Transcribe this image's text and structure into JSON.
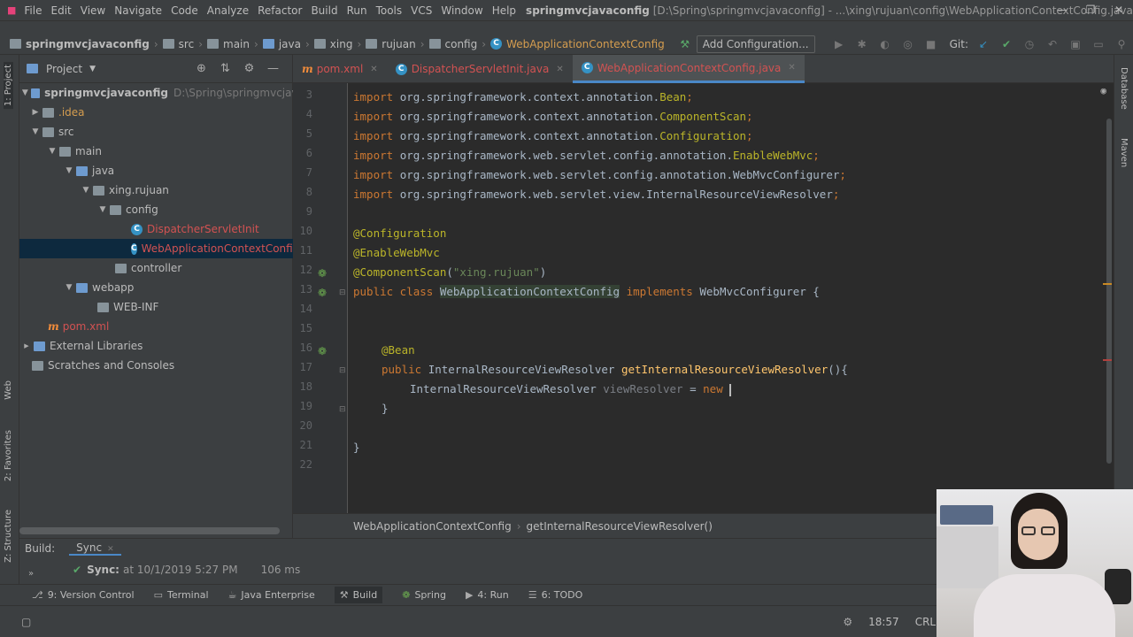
{
  "menubar": {
    "items": [
      "File",
      "Edit",
      "View",
      "Navigate",
      "Code",
      "Analyze",
      "Refactor",
      "Build",
      "Run",
      "Tools",
      "VCS",
      "Window",
      "Help"
    ],
    "title_bold": "springmvcjavaconfig",
    "title_rest": " [D:\\Spring\\springmvcjavaconfig] - ...\\xing\\rujuan\\config\\WebApplicationContextConfig.java"
  },
  "breadcrumb": {
    "items": [
      "springmvcjavaconfig",
      "src",
      "main",
      "java",
      "xing",
      "rujuan",
      "config",
      "WebApplicationContextConfig"
    ]
  },
  "toolbar": {
    "add_configuration": "Add Configuration...",
    "git_label": "Git:"
  },
  "left_stripe": {
    "project": "1: Project",
    "web": "Web",
    "favorites": "2: Favorites",
    "structure": "Z: Structure"
  },
  "right_stripe": {
    "database": "Database",
    "maven": "Maven"
  },
  "project_panel": {
    "title": "Project",
    "tree": [
      {
        "label": "springmvcjavaconfig",
        "path": "D:\\Spring\\springmvcjavacon"
      },
      {
        "label": ".idea"
      },
      {
        "label": "src"
      },
      {
        "label": "main"
      },
      {
        "label": "java"
      },
      {
        "label": "xing.rujuan"
      },
      {
        "label": "config"
      },
      {
        "label": "DispatcherServletInit"
      },
      {
        "label": "WebApplicationContextConfig"
      },
      {
        "label": "controller"
      },
      {
        "label": "webapp"
      },
      {
        "label": "WEB-INF"
      },
      {
        "label": "pom.xml"
      },
      {
        "label": "External Libraries"
      },
      {
        "label": "Scratches and Consoles"
      }
    ]
  },
  "tabs": [
    {
      "label": "pom.xml"
    },
    {
      "label": "DispatcherServletInit.java"
    },
    {
      "label": "WebApplicationContextConfig.java"
    }
  ],
  "editor": {
    "line_numbers": [
      "3",
      "4",
      "5",
      "6",
      "7",
      "8",
      "9",
      "10",
      "11",
      "12",
      "13",
      "14",
      "15",
      "16",
      "17",
      "18",
      "19",
      "20",
      "21",
      "22"
    ],
    "lines": {
      "l3_pkg": "org.springframework.context.annotation.",
      "l3_cls": "Bean",
      "l4_pkg": "org.springframework.context.annotation.",
      "l4_cls": "ComponentScan",
      "l5_pkg": "org.springframework.context.annotation.",
      "l5_cls": "Configuration",
      "l6_pkg": "org.springframework.web.servlet.config.annotation.",
      "l6_cls": "EnableWebMvc",
      "l7_pkg": "org.springframework.web.servlet.config.annotation.",
      "l7_cls": "WebMvcConfigurer",
      "l8_pkg": "org.springframework.web.servlet.view.",
      "l8_cls": "InternalResourceViewResolver",
      "import_kw": "import",
      "ann_configuration": "@Configuration",
      "ann_enablewebmvc": "@EnableWebMvc",
      "ann_componentscan": "@ComponentScan",
      "scan_arg": "\"xing.rujuan\"",
      "public_class": "public class",
      "class_name": "WebApplicationContextConfig",
      "implements": "implements",
      "interface": "WebMvcConfigurer {",
      "ann_bean": "@Bean",
      "public_kw": "public",
      "return_type": "InternalResourceViewResolver",
      "method_name": "getInternalResourceViewResolver",
      "method_tail": "(){",
      "var_type": "InternalResourceViewResolver",
      "var_name": "viewResolver",
      "assign": " = ",
      "new_kw": "new",
      "close_method": "}",
      "close_class": "}"
    }
  },
  "editor_breadcrumb": {
    "class": "WebApplicationContextConfig",
    "method": "getInternalResourceViewResolver()"
  },
  "build_panel": {
    "label": "Build:",
    "tab": "Sync",
    "sync_label": "Sync:",
    "sync_time": "at 10/1/2019 5:27 PM",
    "duration": "106 ms"
  },
  "tool_windows": [
    {
      "label": "9: Version Control"
    },
    {
      "label": "Terminal"
    },
    {
      "label": "Java Enterprise"
    },
    {
      "label": "Build"
    },
    {
      "label": "Spring"
    },
    {
      "label": "4: Run"
    },
    {
      "label": "6: TODO"
    }
  ],
  "status": {
    "position": "18:57",
    "line_ending": "CRLF"
  }
}
